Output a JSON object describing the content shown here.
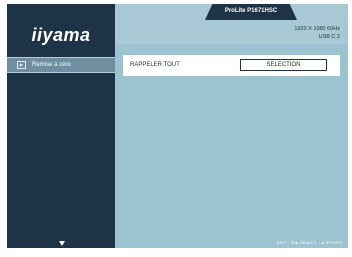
{
  "sidebar": {
    "logo": "iiyama",
    "items": [
      {
        "label": "Remise à zéro",
        "icon": "reset-icon",
        "selected": true
      }
    ],
    "scroll_down_icon": "triangle-down-icon"
  },
  "header": {
    "model": "ProLite P1671HSC",
    "resolution": "1920 X 1080   60Hz",
    "input": "USB C  2"
  },
  "main": {
    "rows": [
      {
        "label": "RAPPELER TOUT",
        "button": "SELECTION"
      }
    ]
  },
  "footer": {
    "hint": "EXIT : ⏻/⇦   SELECT : ▲/▼PUSH"
  },
  "colors": {
    "sidebar": "#1e3348",
    "background": "#9cc4d0",
    "selected_item": "#6f8ea1"
  }
}
